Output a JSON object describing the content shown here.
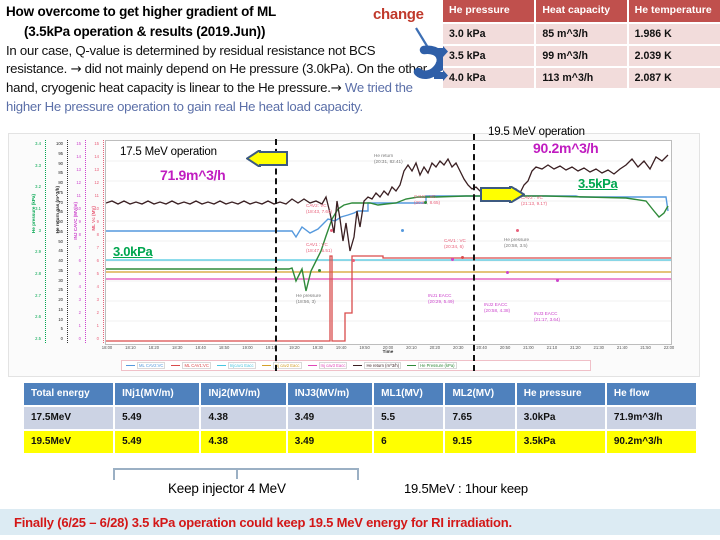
{
  "header": {
    "title_line1": "How overcome to get higher gradient of ML",
    "title_line2": "(3.5kPa operation & results (2019.Jun))",
    "body_part1": "In our case, Q-value is determined by residual resistance not BCS resistance. ",
    "body_arrow1": "→",
    "body_part2": " did not mainly depend on He pressure (3.0kPa). On the other hand, cryogenic heat capacity is linear to the He pressure.",
    "body_arrow2": "→",
    "body_tail": " We tried the higher He pressure operation to gain real He heat load capacity.",
    "change_label": "change"
  },
  "he_table": {
    "headers": [
      "He pressure",
      "Heat capacity",
      "He temperature"
    ],
    "rows": [
      [
        "3.0 kPa",
        "85 m^3/h",
        "1.986 K"
      ],
      [
        "3.5 kPa",
        "99 m^3/h",
        "2.039 K"
      ],
      [
        "4.0 kPa",
        "113 m^3/h",
        "2.087 K"
      ]
    ],
    "header_color": "#c0504d",
    "row_color": "#f2dcdb"
  },
  "annotations": {
    "left_operation": "17.5 MeV operation",
    "left_flow": "71.9m^3/h",
    "left_pressure": "3.0kPa",
    "right_operation": "19.5 MeV operation",
    "right_flow": "90.2m^3/h",
    "right_pressure": "3.5kPa"
  },
  "results_table": {
    "headers": [
      "Total energy",
      "INj1(MV/m)",
      "INj2(MV/m)",
      "INJ3(MV/m)",
      "ML1(MV)",
      "ML2(MV)",
      "He pressure",
      "He flow"
    ],
    "rows": [
      {
        "cells": [
          "17.5MeV",
          "5.49",
          "4.38",
          "3.49",
          "5.5",
          "7.65",
          "3.0kPa",
          "71.9m^3/h"
        ]
      },
      {
        "cells": [
          "19.5MeV",
          "5.49",
          "4.38",
          "3.49",
          "6",
          "9.15",
          "3.5kPa",
          "90.2m^3/h"
        ]
      }
    ],
    "header_color": "#4f81bd",
    "row1_color": "#ccd3e4",
    "row2_color": "#ffff00"
  },
  "captions": {
    "bracket_label": "Keep injector 4 MeV",
    "right_label": "19.5MeV : 1hour keep",
    "footer": "Finally (6/25 – 6/28) 3.5 kPa operation could keep 19.5 MeV energy for RI irradiation."
  },
  "chart_data": {
    "type": "line",
    "title": "",
    "xlabel": "Time",
    "ylabel": "",
    "xticks": [
      "18:00",
      "18:10",
      "18:20",
      "18:30",
      "18:40",
      "18:50",
      "19:00",
      "19:10",
      "19:20",
      "19:30",
      "19:40",
      "19:50",
      "20:00",
      "20:10",
      "20:20",
      "20:30",
      "20:40",
      "20:50",
      "21:00",
      "21:10",
      "21:20",
      "21:30",
      "21:40",
      "21:50",
      "22:00"
    ],
    "axes": [
      {
        "name": "He pressure (kPa)",
        "color": "#00a64f",
        "ticks": [
          "3.4",
          "3.3",
          "3.2",
          "3.1",
          "3",
          "2.9",
          "2.8",
          "2.7",
          "2.6",
          "2.5"
        ],
        "range": [
          2.5,
          3.45
        ]
      },
      {
        "name": "He return gas (m^3/h)",
        "color": "#222222",
        "ticks": [
          "100",
          "95",
          "90",
          "85",
          "80",
          "75",
          "70",
          "65",
          "60",
          "55",
          "50",
          "45",
          "40",
          "35",
          "30",
          "25",
          "20",
          "15",
          "10",
          "5",
          "0"
        ],
        "range": [
          0,
          100
        ]
      },
      {
        "name": "INJ CAVC (MV/m)",
        "color": "#cc44cc",
        "ticks": [
          "15",
          "14",
          "13",
          "12",
          "11",
          "10",
          "9",
          "8",
          "7",
          "6",
          "5",
          "4",
          "3",
          "2",
          "1",
          "0"
        ],
        "range": [
          0,
          15
        ]
      },
      {
        "name": "ML Vc (MV)",
        "color": "#e8607a",
        "ticks": [
          "15",
          "14",
          "13",
          "12",
          "11",
          "10",
          "9",
          "8",
          "7",
          "6",
          "5",
          "4",
          "3",
          "2",
          "1",
          "0"
        ],
        "range": [
          0,
          15
        ]
      }
    ],
    "legend": [
      {
        "label": "ML CAV2:VC",
        "color": "#5599dd"
      },
      {
        "label": "ML CAV1:VC",
        "color": "#d94b4b"
      },
      {
        "label": "Injcav1 Eacc",
        "color": "#49c6e0"
      },
      {
        "label": "Inj cav2 Eacc",
        "color": "#d4a12a"
      },
      {
        "label": "Inj cav3 Eacc",
        "color": "#e048b8"
      },
      {
        "label": "He return (m^3/h)",
        "color": "#3a1f22"
      },
      {
        "label": "He Pressure (kPa)",
        "color": "#2f8a3a"
      }
    ],
    "callouts": [
      {
        "label": "CAV2: VC",
        "value": "(18:43, 7.64)"
      },
      {
        "label": "CAV1 : VC",
        "value": "(18:47, 5.51)"
      },
      {
        "label": "He pressure",
        "value": "(18:56, 3)"
      },
      {
        "label": "He return",
        "value": "(20:31, 82.41)"
      },
      {
        "label": "CAV2 : VC",
        "value": "(20:27, 8.65)"
      },
      {
        "label": "CAV1 : VC",
        "value": "(20:34, 6)"
      },
      {
        "label": "CAV2 : VC",
        "value": "(21:13, 9.17)"
      },
      {
        "label": "He pressure",
        "value": "(20:58, 3.5)"
      },
      {
        "label": "INJ1 EACC",
        "value": "(20:29, 5.49)"
      },
      {
        "label": "INJ2 EACC",
        "value": "(20:58, 4.38)"
      },
      {
        "label": "INJ3 EACC",
        "value": "(21:17, 3.64)"
      }
    ]
  }
}
